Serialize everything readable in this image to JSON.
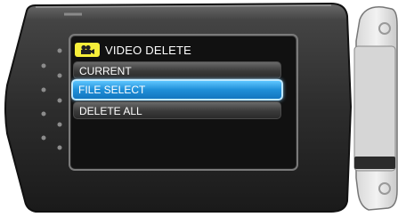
{
  "header": {
    "mode_icon": "movie-camera-icon",
    "title": "VIDEO DELETE",
    "icon_color": "#f7ef3a"
  },
  "menu": {
    "items": [
      {
        "label": "CURRENT",
        "selected": false
      },
      {
        "label": "FILE SELECT",
        "selected": true
      },
      {
        "label": "DELETE ALL",
        "selected": false
      }
    ],
    "highlight_color": "#1f8fd8"
  }
}
